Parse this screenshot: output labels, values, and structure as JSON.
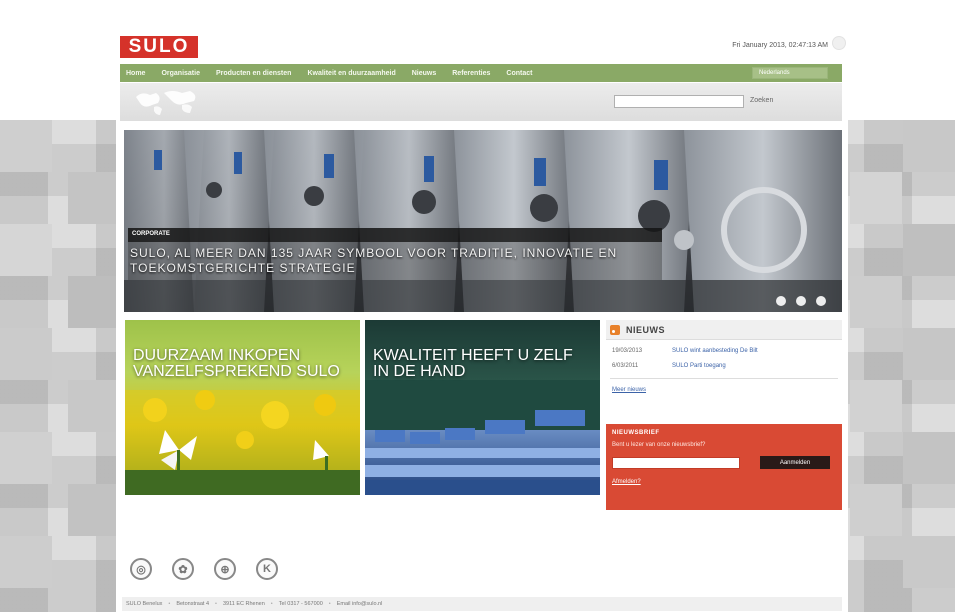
{
  "header": {
    "logo_text": "SULO",
    "date": "Fri January 2013, 02:47:13 AM"
  },
  "nav": {
    "items": [
      {
        "label": "Home"
      },
      {
        "label": "Organisatie"
      },
      {
        "label": "Producten en diensten"
      },
      {
        "label": "Kwaliteit en duurzaamheid"
      },
      {
        "label": "Nieuws"
      },
      {
        "label": "Referenties"
      },
      {
        "label": "Contact"
      }
    ],
    "language": "Nederlands"
  },
  "search": {
    "value": "",
    "label": "Zoeken"
  },
  "hero": {
    "tag": "CORPORATE",
    "title": "SULO, AL MEER DAN 135 JAAR SYMBOOL VOOR TRADITIE, INNOVATIE EN TOEKOMSTGERICHTE STRATEGIE"
  },
  "promos": [
    {
      "title": "DUURZAAM INKOPEN VANZELFSPREKEND SULO"
    },
    {
      "title": "KWALITEIT HEEFT U ZELF IN DE HAND"
    }
  ],
  "news": {
    "title": "NIEUWS",
    "items": [
      {
        "date": "19/03/2013",
        "text": "SULO wint aanbesteding De Bilt"
      },
      {
        "date": "6/03/2011",
        "text": "SULO Parti toegang"
      }
    ],
    "more": "Meer nieuws"
  },
  "newsletter": {
    "title": "NIEUWSBRIEF",
    "text": "Bent u lezer van onze nieuwsbrief?",
    "input_value": "",
    "button": "Aanmelden",
    "link": "Afmelden?"
  },
  "footer": {
    "parts": [
      "SULO Benelux",
      "Betonstraat 4",
      "3911 EC Rhenen",
      "Tel 0317 - 567000",
      "Email info@sulo.nl"
    ]
  },
  "colors": {
    "brand_red": "#d5322a",
    "nav_green": "#8aa966",
    "newsletter_red": "#d94a34",
    "link_blue": "#3c63a8"
  }
}
